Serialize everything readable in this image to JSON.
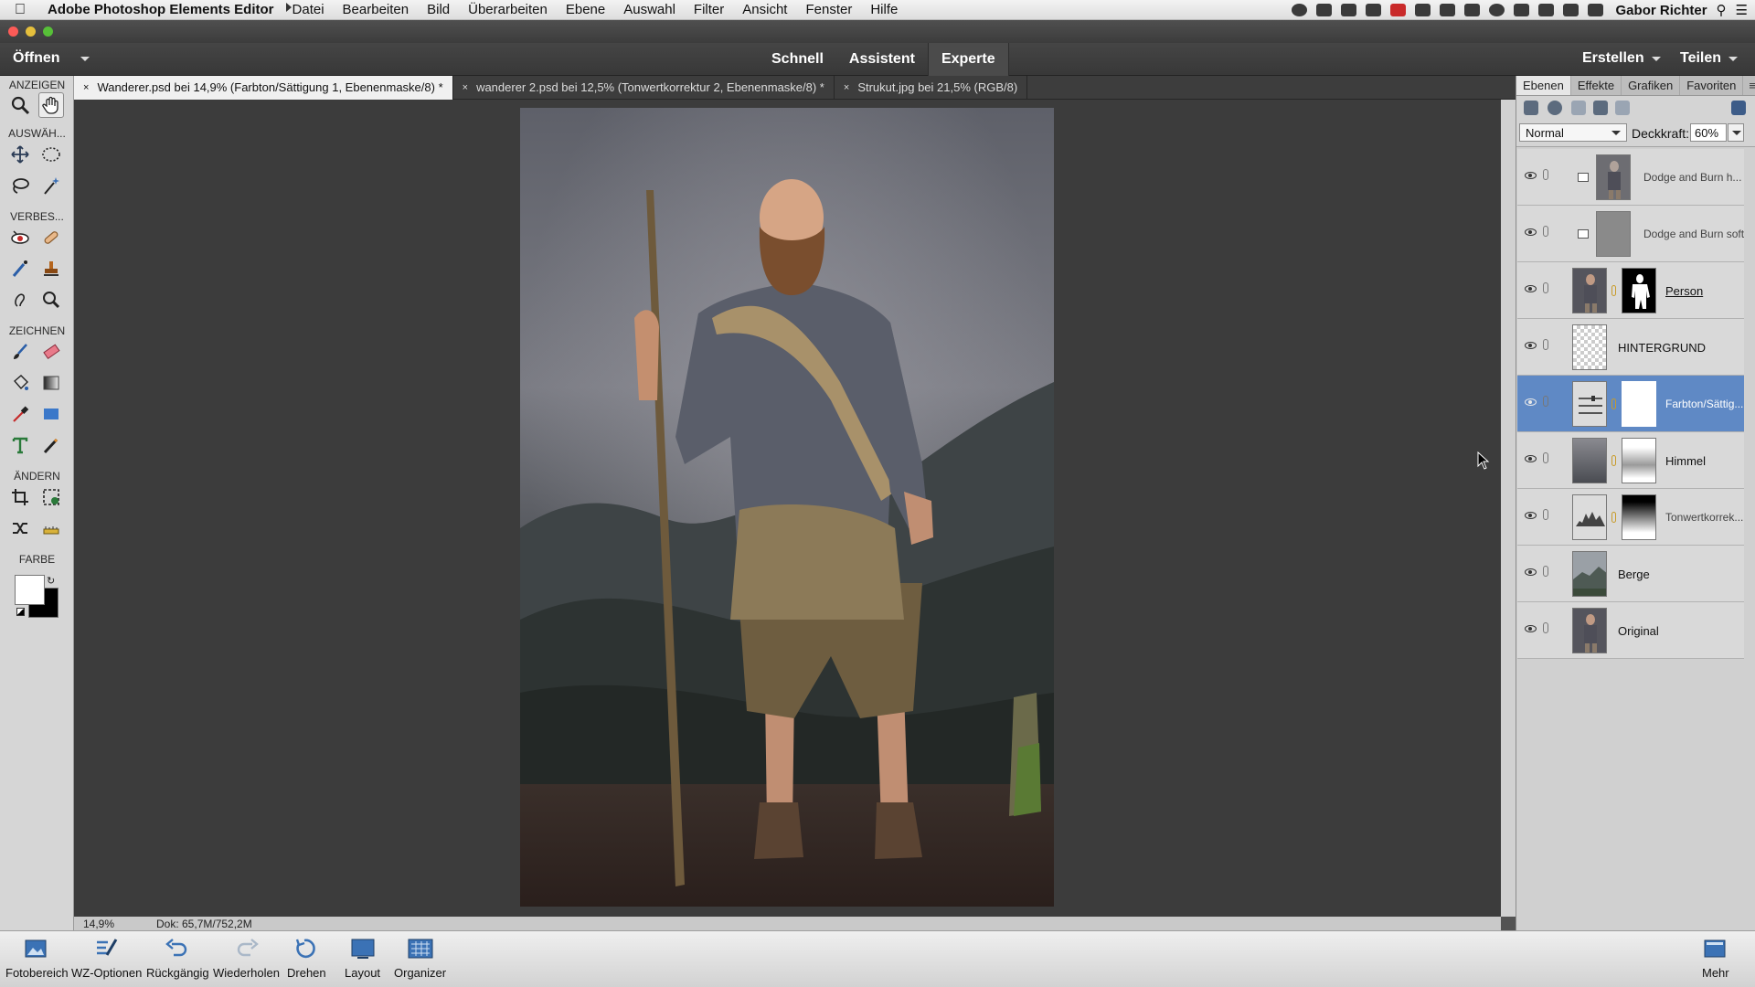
{
  "menubar": {
    "app_name": "Adobe Photoshop Elements Editor",
    "items": [
      "Datei",
      "Bearbeiten",
      "Bild",
      "Überarbeiten",
      "Ebene",
      "Auswahl",
      "Filter",
      "Ansicht",
      "Fenster",
      "Hilfe"
    ],
    "user": "Gabor Richter"
  },
  "modebar": {
    "open_label": "Öffnen",
    "tabs": [
      "Schnell",
      "Assistent",
      "Experte"
    ],
    "active_tab": "Experte",
    "create_label": "Erstellen",
    "share_label": "Teilen"
  },
  "toolbox": {
    "sections": [
      "ANZEIGEN",
      "AUSWÄH...",
      "VERBES...",
      "ZEICHNEN",
      "ÄNDERN",
      "FARBE"
    ],
    "selected_tool": "hand-tool"
  },
  "documents": {
    "tabs": [
      "Wanderer.psd bei 14,9% (Farbton/Sättigung 1, Ebenenmaske/8) *",
      "wanderer 2.psd bei 12,5% (Tonwertkorrektur 2, Ebenenmaske/8) *",
      "Strukut.jpg bei 21,5% (RGB/8)"
    ],
    "active_index": 0,
    "close_glyph": "×"
  },
  "status": {
    "zoom": "14,9%",
    "doc_size": "Dok: 65,7M/752,2M"
  },
  "layers_panel": {
    "tabs": [
      "Ebenen",
      "Effekte",
      "Grafiken",
      "Favoriten"
    ],
    "active_tab": "Ebenen",
    "blend_mode": "Normal",
    "opacity_label": "Deckkraft:",
    "opacity": "60%",
    "layers": [
      {
        "name": "Dodge and Burn h...",
        "thumb": "figure",
        "mask": null,
        "clipped": true,
        "selected": false
      },
      {
        "name": "Dodge and Burn soft",
        "thumb": "gray",
        "mask": null,
        "clipped": true,
        "selected": false
      },
      {
        "name": "Person",
        "thumb": "figure",
        "mask": "silhouette",
        "clipped": false,
        "selected": false
      },
      {
        "name": "HINTERGRUND",
        "thumb": "transparent",
        "mask": null,
        "clipped": false,
        "selected": false
      },
      {
        "name": "Farbton/Sättig...",
        "thumb": "adjust-hue",
        "mask": "white",
        "clipped": false,
        "selected": true
      },
      {
        "name": "Himmel",
        "thumb": "sky",
        "mask": "sky-mask",
        "clipped": false,
        "selected": false
      },
      {
        "name": "Tonwertkorrek...",
        "thumb": "levels",
        "mask": "gradient",
        "clipped": false,
        "selected": false
      },
      {
        "name": "Berge",
        "thumb": "mountains",
        "mask": null,
        "clipped": false,
        "selected": false
      },
      {
        "name": "Original",
        "thumb": "figure",
        "mask": null,
        "clipped": false,
        "selected": false
      }
    ]
  },
  "taskbar": {
    "buttons": [
      "Fotobereich",
      "WZ-Optionen",
      "Rückgängig",
      "Wiederholen",
      "Drehen",
      "Layout",
      "Organizer"
    ],
    "more_label": "Mehr"
  },
  "colors": {
    "selection_blue": "#5f89c5",
    "foreground": "#ffffff",
    "background": "#000000",
    "chain_gold": "#c89b2a"
  }
}
